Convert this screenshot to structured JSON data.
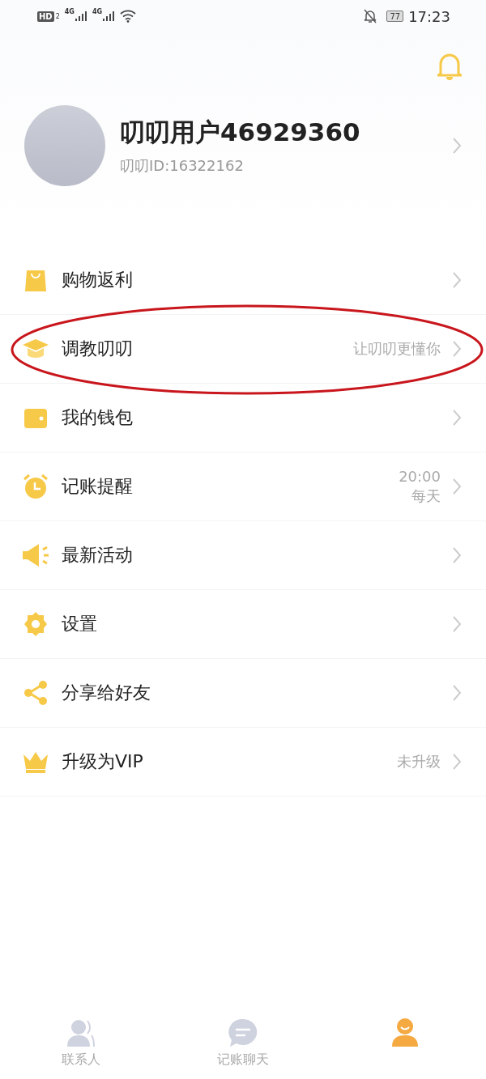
{
  "status_bar": {
    "hd": "HD",
    "sim": "2",
    "net1": "4G",
    "net2": "4G",
    "battery": "77",
    "time": "17:23"
  },
  "profile": {
    "name": "叨叨用户46929360",
    "id_text": "叨叨ID:16322162"
  },
  "menu": [
    {
      "kind": "bag",
      "label": "购物返利",
      "circled": false
    },
    {
      "kind": "cap",
      "label": "调教叨叨",
      "hint": [
        "让叨叨更懂你"
      ],
      "circled": true
    },
    {
      "kind": "wallet",
      "label": "我的钱包",
      "circled": false
    },
    {
      "kind": "alarm",
      "label": "记账提醒",
      "hint": [
        "20:00",
        "每天"
      ],
      "circled": false
    },
    {
      "kind": "megaphone",
      "label": "最新活动",
      "circled": false
    },
    {
      "kind": "gear",
      "label": "设置",
      "circled": false
    },
    {
      "kind": "share",
      "label": "分享给好友",
      "circled": false
    },
    {
      "kind": "crown",
      "label": "升级为VIP",
      "hint": [
        "未升级"
      ],
      "circled": false
    }
  ],
  "tabs": [
    {
      "label": "联系人",
      "selected": false
    },
    {
      "label": "记账聊天",
      "selected": false
    },
    {
      "selected": true
    }
  ]
}
